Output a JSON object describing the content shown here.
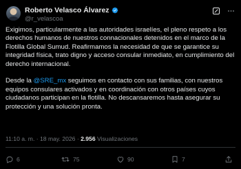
{
  "post": {
    "author": {
      "name": "Roberto Velasco Álvarez",
      "handle": "@r_velascoa"
    },
    "paragraphs": [
      {
        "pre": "Exigimos, particularmente a las autoridades israelíes, el pleno respeto a los derechos humanos de nuestros connacionales detenidos en el marco de la Flotilla Global Sumud. Reafirmamos la necesidad de que se garantice su integridad física, trato digno y acceso consular inmediato, en cumplimiento del derecho internacional."
      },
      {
        "pre": "Desde la ",
        "mention": "@SRE_mx",
        "post": " seguimos en contacto con sus familias, con nuestros equipos consulares activados y en coordinación con otros países cuyos ciudadanos participan en la flotilla. No descansaremos hasta asegurar su protección y una solución pronta."
      }
    ],
    "meta": {
      "time": "11:10 a. m.",
      "separator": "·",
      "date": "18 may. 2026",
      "views_count": "2.956",
      "views_label": "Visualizaciones"
    },
    "stats": {
      "replies": "6",
      "reposts": "75",
      "likes": "90",
      "bookmarks": "7"
    }
  },
  "colors": {
    "background": "#000000",
    "text": "#e7e9ea",
    "muted": "#71767b",
    "accent": "#1d9bf0",
    "divider": "#2f3336"
  },
  "icons": [
    "verified-badge-icon",
    "grok-icon",
    "more-icon",
    "reply-icon",
    "repost-icon",
    "like-icon",
    "bookmark-icon",
    "share-icon"
  ]
}
